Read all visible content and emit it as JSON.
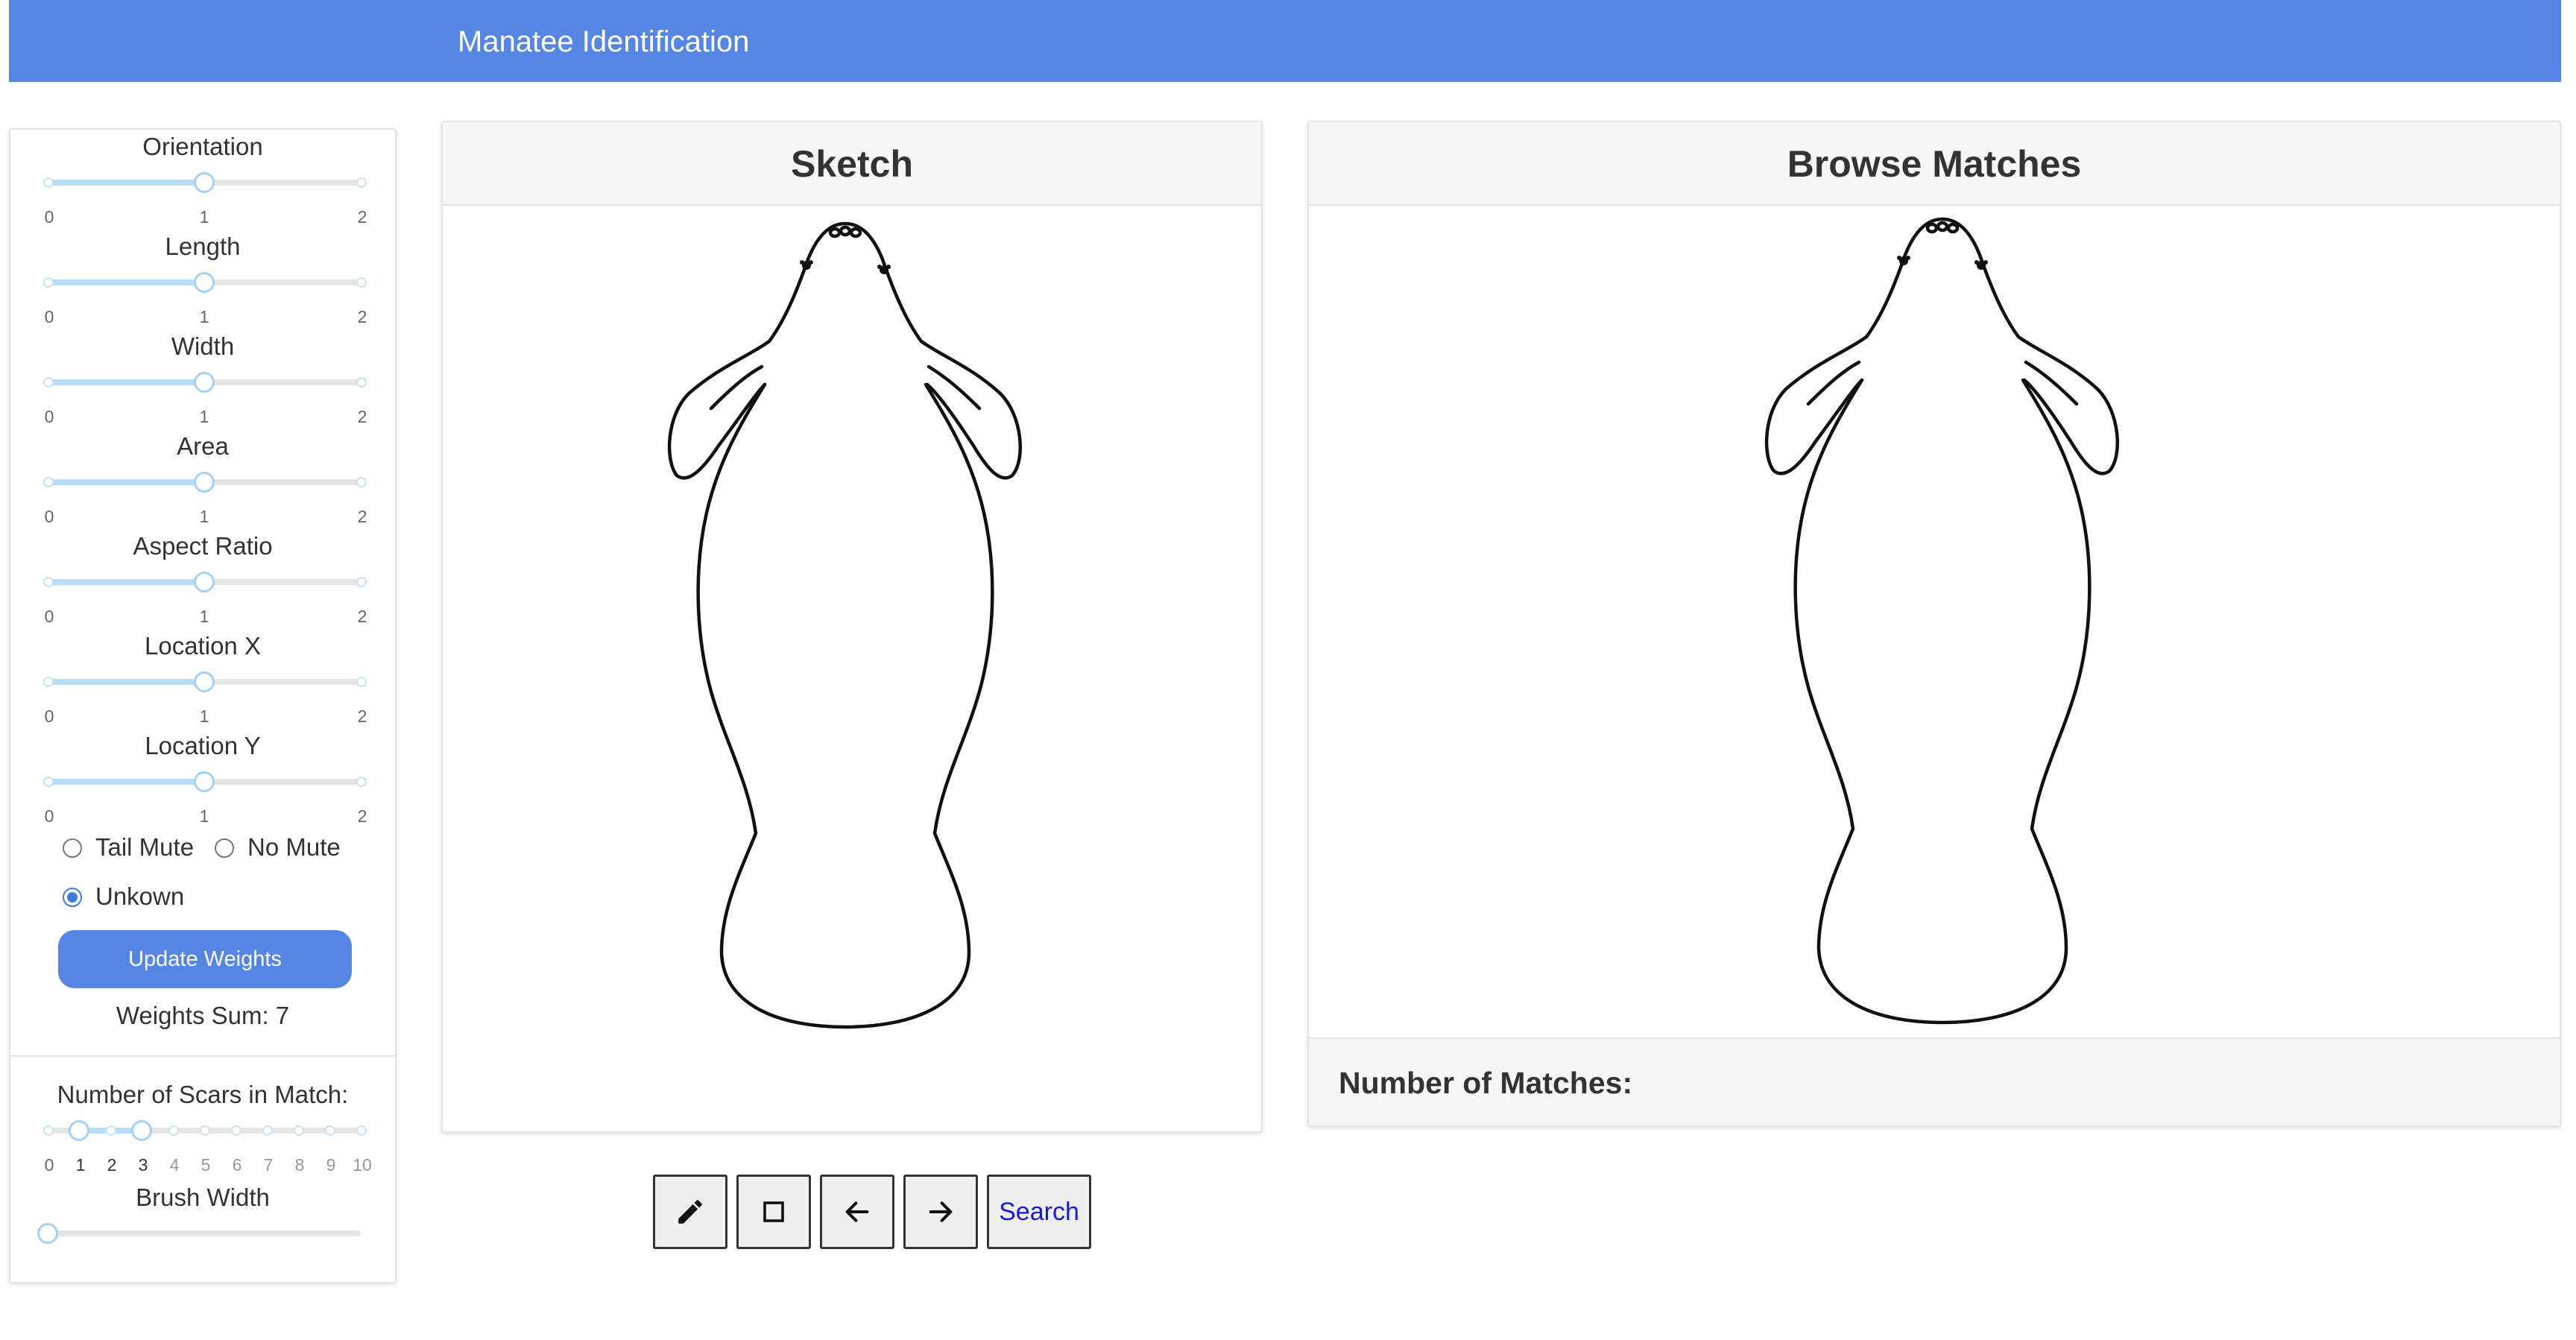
{
  "header": {
    "title": "Manatee Identification"
  },
  "weights": {
    "sliders": [
      {
        "label": "Orientation",
        "value": 1,
        "min_label": "0",
        "mid_label": "1",
        "max_label": "2"
      },
      {
        "label": "Length",
        "value": 1,
        "min_label": "0",
        "mid_label": "1",
        "max_label": "2"
      },
      {
        "label": "Width",
        "value": 1,
        "min_label": "0",
        "mid_label": "1",
        "max_label": "2"
      },
      {
        "label": "Area",
        "value": 1,
        "min_label": "0",
        "mid_label": "1",
        "max_label": "2"
      },
      {
        "label": "Aspect Ratio",
        "value": 1,
        "min_label": "0",
        "mid_label": "1",
        "max_label": "2"
      },
      {
        "label": "Location X",
        "value": 1,
        "min_label": "0",
        "mid_label": "1",
        "max_label": "2"
      },
      {
        "label": "Location Y",
        "value": 1,
        "min_label": "0",
        "mid_label": "1",
        "max_label": "2"
      }
    ],
    "mute_options": [
      {
        "label": "Tail Mute",
        "checked": false
      },
      {
        "label": "No Mute",
        "checked": false
      },
      {
        "label": "Unkown",
        "checked": true
      }
    ],
    "update_label": "Update Weights",
    "sum_text": "Weights Sum: 7"
  },
  "scars": {
    "label": "Number of Scars in Match:",
    "ticks": [
      "0",
      "1",
      "2",
      "3",
      "4",
      "5",
      "6",
      "7",
      "8",
      "9",
      "10"
    ],
    "range_low": 1,
    "range_high": 3
  },
  "brush": {
    "label": "Brush Width",
    "value": 0
  },
  "sketch": {
    "title": "Sketch",
    "tools": [
      {
        "icon": "pencil-icon"
      },
      {
        "icon": "square-icon"
      },
      {
        "icon": "arrow-left-icon"
      },
      {
        "icon": "arrow-right-icon"
      }
    ],
    "search_label": "Search"
  },
  "matches": {
    "title": "Browse Matches",
    "count_label": "Number of Matches:"
  },
  "colors": {
    "accent": "#5686e4",
    "slider_fill": "#b9dcf7",
    "search_text": "#1a1ad6"
  }
}
